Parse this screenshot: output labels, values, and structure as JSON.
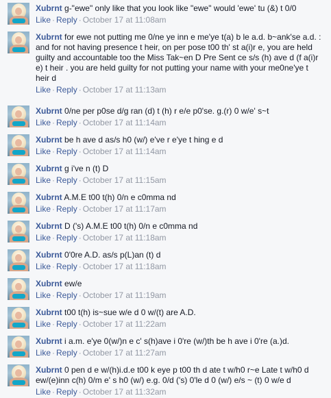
{
  "comments": [
    {
      "author": "Xubrnt",
      "text": "g-\"ewe\" only like that you look like \"ewe\" would 'ewe' tu (&) t 0/0",
      "like": "Like",
      "reply": "Reply",
      "sep": "·",
      "time": "October 17 at 11:08am"
    },
    {
      "author": "Xubrnt",
      "text": "for ewe not putting me 0/ne ye inn e me'ye t(a) b le a.d. b~ank'se a.d. : and for not having presence t heir, on per pose t00 th' st a(i)r e, you are held guilty and accountable too the Miss Tak~en D Pre Sent ce s/s (h) ave d (f a(i)r e) t heir . you are held guilty for not putting your name with your me0ne'ye t heir d",
      "like": "Like",
      "reply": "Reply",
      "sep": "·",
      "time": "October 17 at 11:13am"
    },
    {
      "author": "Xubrnt",
      "text": "0/ne per p0se d/g ran (d) t (h) r e/e p0'se. g.(r) 0 w/e' s~t",
      "like": "Like",
      "reply": "Reply",
      "sep": "·",
      "time": "October 17 at 11:14am"
    },
    {
      "author": "Xubrnt",
      "text": "be h ave d as/s h0 (w/) e've r e'ye t hing e d",
      "like": "Like",
      "reply": "Reply",
      "sep": "·",
      "time": "October 17 at 11:14am"
    },
    {
      "author": "Xubrnt",
      "text": "g i've n (t) D",
      "like": "Like",
      "reply": "Reply",
      "sep": "·",
      "time": "October 17 at 11:15am"
    },
    {
      "author": "Xubrnt",
      "text": "A.M.E t00 t(h) 0/n e c0mma nd",
      "like": "Like",
      "reply": "Reply",
      "sep": "·",
      "time": "October 17 at 11:17am"
    },
    {
      "author": "Xubrnt",
      "text": "D ('s) A.M.E t00 t(h) 0/n e c0mma nd",
      "like": "Like",
      "reply": "Reply",
      "sep": "·",
      "time": "October 17 at 11:18am"
    },
    {
      "author": "Xubrnt",
      "text": "0'0re A.D. as/s p(L)an (t) d",
      "like": "Like",
      "reply": "Reply",
      "sep": "·",
      "time": "October 17 at 11:18am"
    },
    {
      "author": "Xubrnt",
      "text": "ew/e",
      "like": "Like",
      "reply": "Reply",
      "sep": "·",
      "time": "October 17 at 11:19am"
    },
    {
      "author": "Xubrnt",
      "text": "t00 t(h) is~sue w/e d 0 w/(t) are A.D.",
      "like": "Like",
      "reply": "Reply",
      "sep": "·",
      "time": "October 17 at 11:22am"
    },
    {
      "author": "Xubrnt",
      "text": "i a.m. e'ye 0(w/)n e c' s(h)ave i 0're (w/)th be h ave i 0're (a.)d.",
      "like": "Like",
      "reply": "Reply",
      "sep": "·",
      "time": "October 17 at 11:27am"
    },
    {
      "author": "Xubrnt",
      "text": "0 pen d e w/(h)i.d.e t00 k eye p t00 th d ate t w/h0 r~e Late t w/h0 d ew/(e)inn c(h) 0/m e' s h0 (w/) e.g. 0/d ('s) 0'le d 0 (w/) e/s ~ (t) 0 w/e d",
      "like": "Like",
      "reply": "Reply",
      "sep": "·",
      "time": "October 17 at 11:32am"
    }
  ]
}
